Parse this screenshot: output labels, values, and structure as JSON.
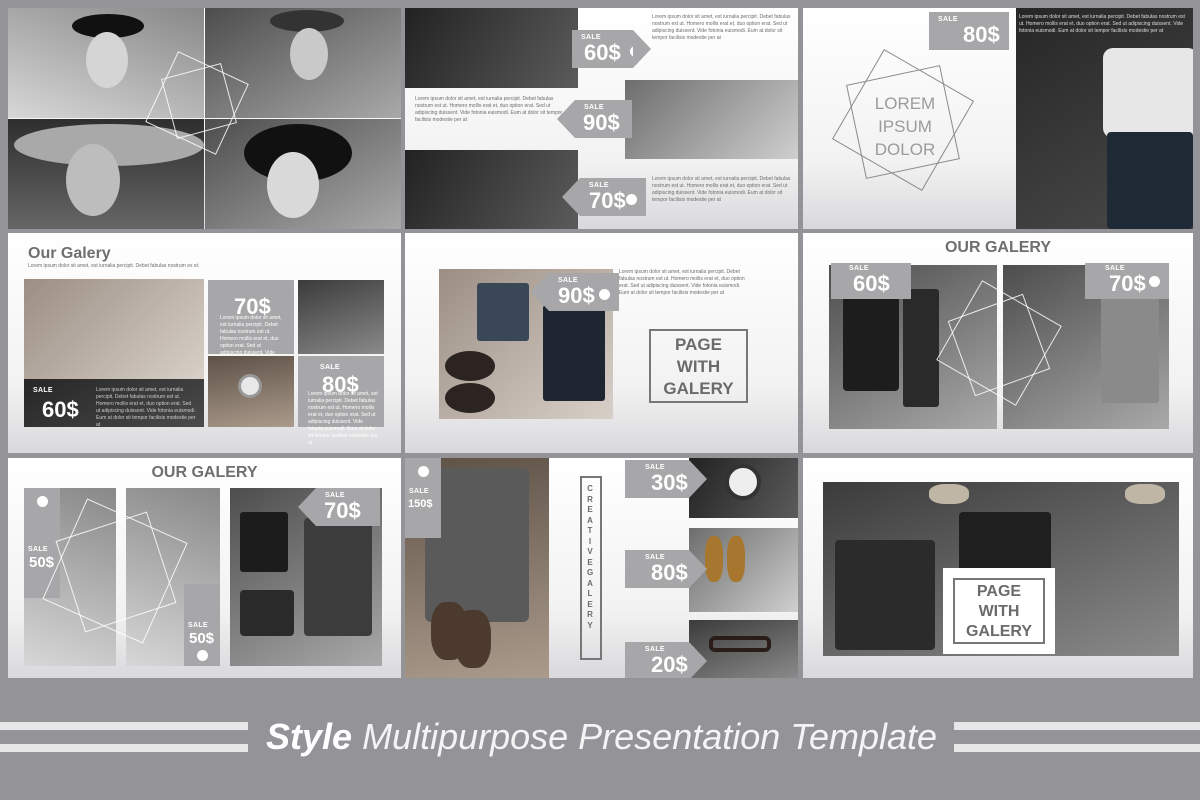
{
  "tags": {
    "sale": "SALE",
    "p60": "60$",
    "p90": "90$",
    "p70": "70$",
    "p80": "80$",
    "p50": "50$",
    "p150": "150$",
    "p30": "30$",
    "p20": "20$"
  },
  "slides": {
    "lorem_title": "LOREM\nIPSUM\nDOLOR",
    "our_galery_small": "Our Galery",
    "our_galery_small_sub": "Lorem ipsum dolor sit amet, est iurnalia percipit. Debet fabulas nostrum ex et.",
    "page_with_galery": "PAGE\nWITH\nGALERY",
    "our_galery_upper": "OUR GALERY",
    "creative_galery": "CREATIVE GALERY",
    "lorem_paragraph": "Lorem ipsum dolor sit amet, est iurnalia percipit. Debet fabulas nostrum est ut. Homero mollis erat et, duo option erat. Sed ut adipiscing duissent. Vide fotonia euismodi. Eum at dolor sit tempor facilisis modestie per at"
  },
  "footer": {
    "brand": "Style",
    "title": "Multipurpose Presentation Template"
  },
  "colors": {
    "background": "#939398",
    "tag": "#a7a7a9",
    "text": "#6f6f6f"
  }
}
